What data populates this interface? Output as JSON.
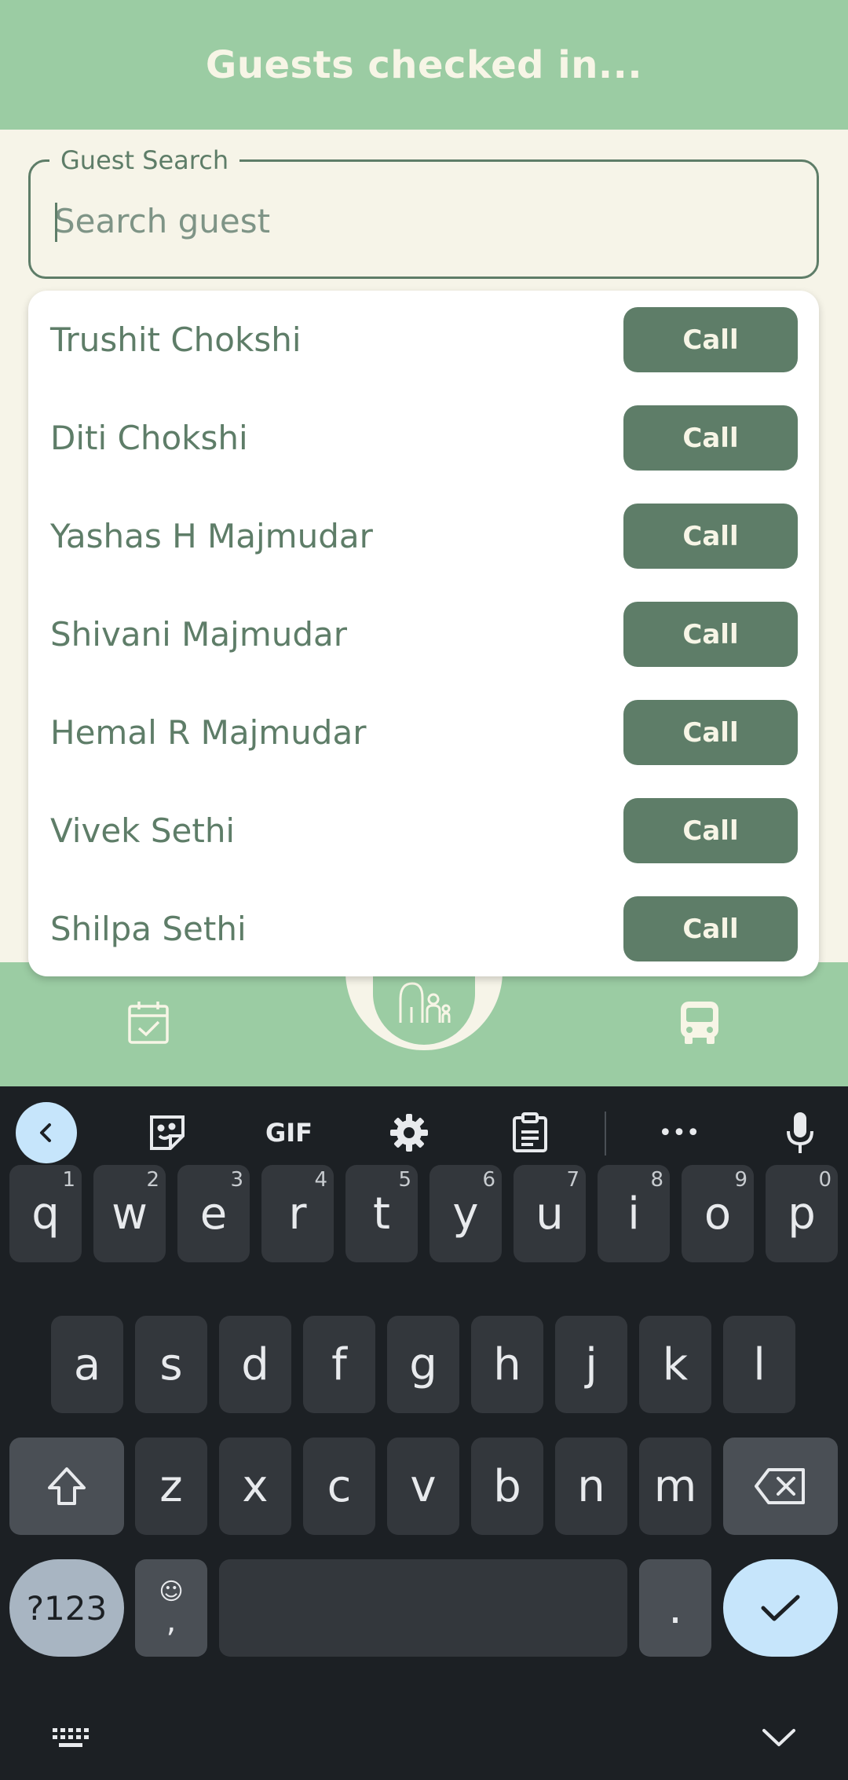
{
  "header": {
    "title": "Guests checked in..."
  },
  "search": {
    "label": "Guest Search",
    "placeholder": "Search guest",
    "value": ""
  },
  "guests": [
    {
      "name": "Trushit Chokshi",
      "action": "Call"
    },
    {
      "name": "Diti Chokshi",
      "action": "Call"
    },
    {
      "name": "Yashas H Majmudar",
      "action": "Call"
    },
    {
      "name": "Shivani Majmudar",
      "action": "Call"
    },
    {
      "name": "Hemal R Majmudar",
      "action": "Call"
    },
    {
      "name": "Vivek Sethi",
      "action": "Call"
    },
    {
      "name": "Shilpa Sethi",
      "action": "Call"
    }
  ],
  "nav": {
    "icons": [
      "calendar-check-icon",
      "family-icon",
      "bus-icon"
    ]
  },
  "keyboard": {
    "toolbar": {
      "gif_label": "GIF",
      "more_label": "•••"
    },
    "row1": [
      {
        "key": "q",
        "hint": "1"
      },
      {
        "key": "w",
        "hint": "2"
      },
      {
        "key": "e",
        "hint": "3"
      },
      {
        "key": "r",
        "hint": "4"
      },
      {
        "key": "t",
        "hint": "5"
      },
      {
        "key": "y",
        "hint": "6"
      },
      {
        "key": "u",
        "hint": "7"
      },
      {
        "key": "i",
        "hint": "8"
      },
      {
        "key": "o",
        "hint": "9"
      },
      {
        "key": "p",
        "hint": "0"
      }
    ],
    "row2": [
      "a",
      "s",
      "d",
      "f",
      "g",
      "h",
      "j",
      "k",
      "l"
    ],
    "row3": [
      "z",
      "x",
      "c",
      "v",
      "b",
      "n",
      "m"
    ],
    "symbols_label": "?123",
    "emoji_label": "☺",
    "comma_label": ",",
    "period_label": "."
  },
  "colors": {
    "accent": "#9bcca3",
    "primary": "#5e7d68",
    "background": "#f6f4e8"
  }
}
